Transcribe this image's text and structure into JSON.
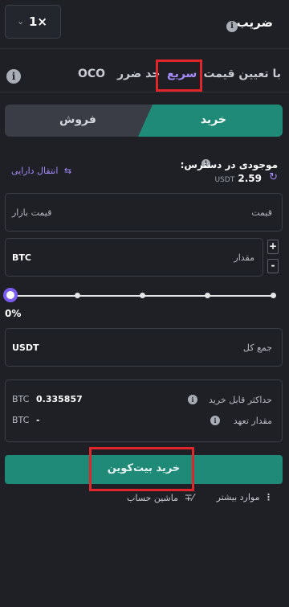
{
  "leverage": {
    "title": "ضریب",
    "value": "1×"
  },
  "order_tabs": [
    {
      "label": "با تعیین قیمت",
      "active": false
    },
    {
      "label": "سریع",
      "active": true
    },
    {
      "label": "حد ضرر",
      "active": false
    },
    {
      "label": "OCO",
      "active": false
    }
  ],
  "side": {
    "buy_label": "خرید",
    "sell_label": "فروش"
  },
  "balance": {
    "label": "موجودی در دسترس:",
    "value": "2.59",
    "unit": "USDT",
    "transfer_label": "انتقال دارایی"
  },
  "price_field": {
    "label": "قیمت",
    "value": "قیمت بازار"
  },
  "amount_field": {
    "label": "مقدار",
    "unit": "BTC",
    "plus": "+",
    "minus": "-"
  },
  "slider": {
    "percent_label": "0%",
    "value": 0
  },
  "total_field": {
    "label": "جمع کل",
    "unit": "USDT"
  },
  "summary": {
    "max_buy_label": "حداکثر قابل خرید",
    "max_buy_value": "0.335857",
    "max_buy_unit": "BTC",
    "commit_label": "مقدار تعهد",
    "commit_value": "-",
    "commit_unit": "BTC"
  },
  "buy_button": {
    "label": "خرید بیت‌کوین"
  },
  "footer": {
    "more_label": "موارد بیشتر",
    "calc_label": "ماشین حساب"
  },
  "colors": {
    "accent": "#a78bfa",
    "buy": "#1f8a78",
    "highlight": "#e0252b"
  }
}
